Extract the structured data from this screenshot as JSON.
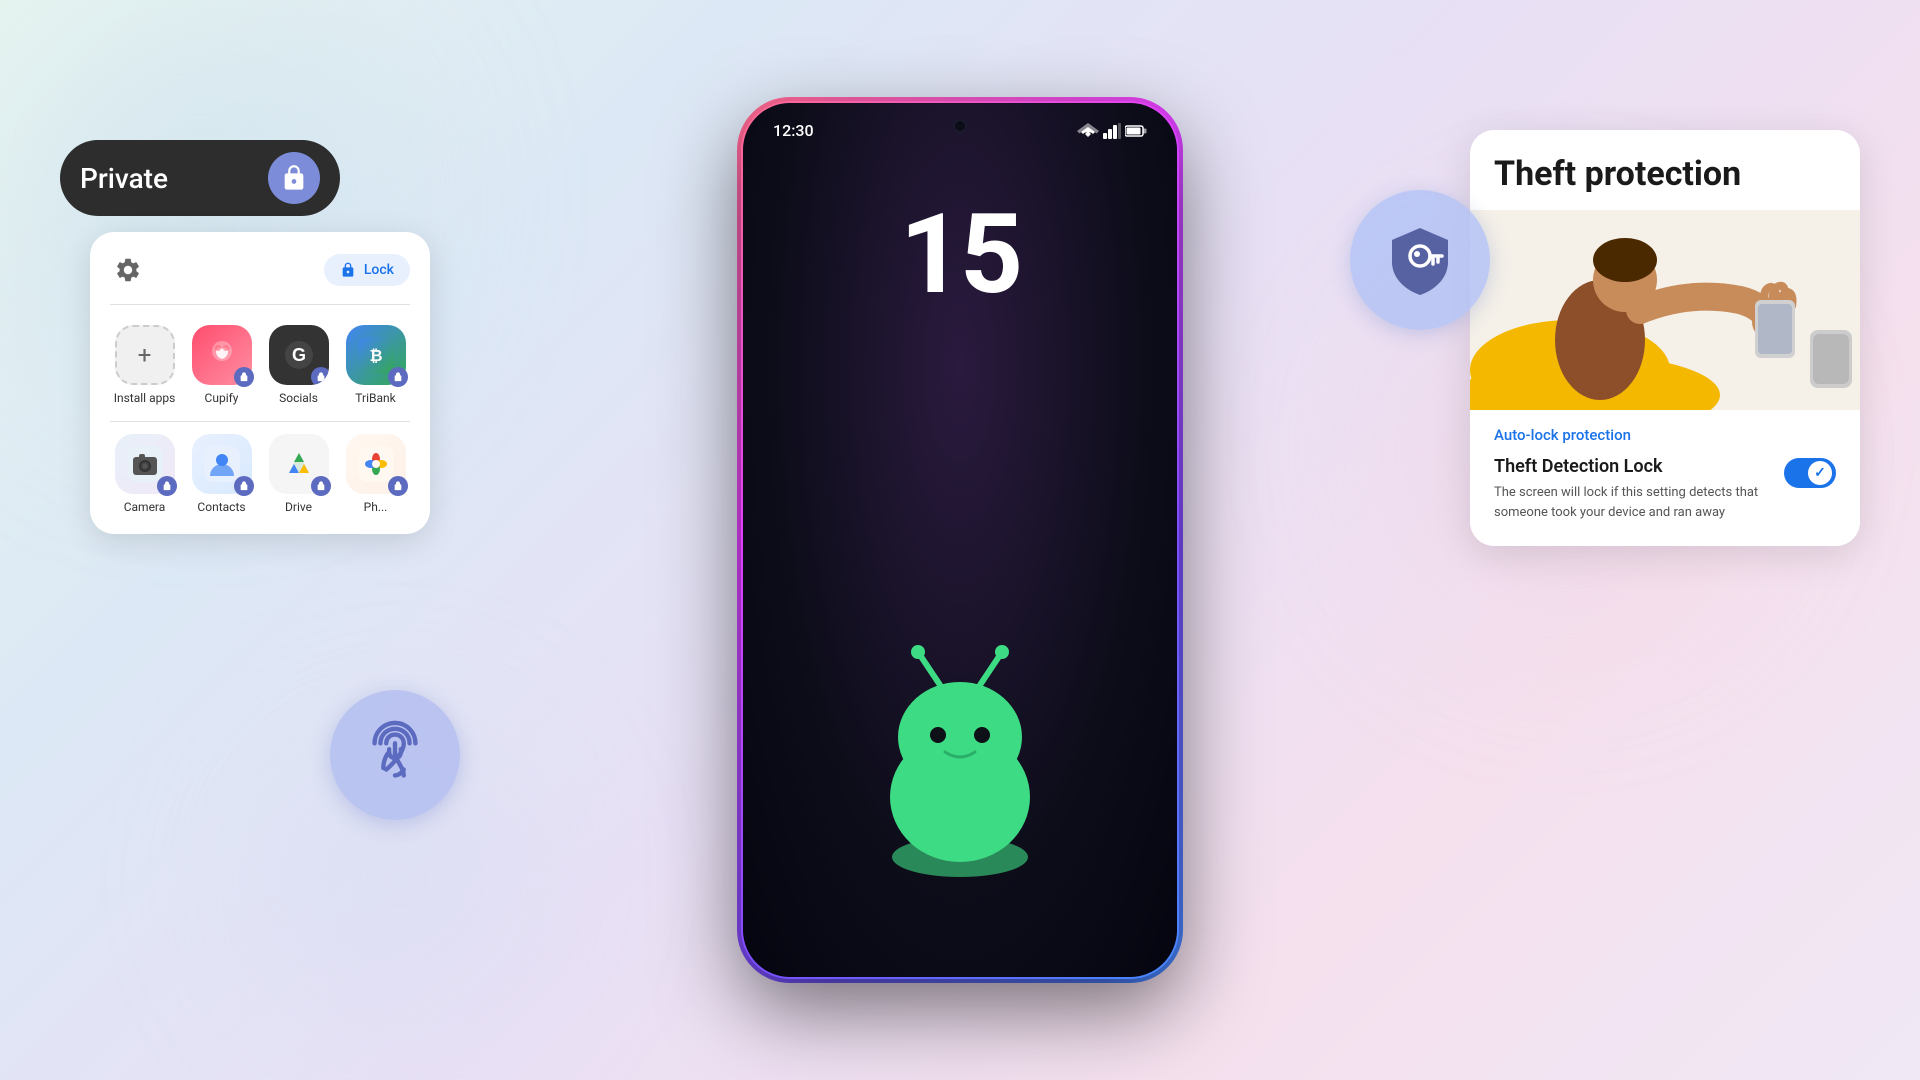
{
  "background": {
    "color_start": "#e8f5f0",
    "color_end": "#f0e8f5"
  },
  "phone": {
    "time": "12:30",
    "clock_display": "15",
    "border_gradient": "linear-gradient(135deg, #ff6b8a, #e040fb, #7c4dff, #448aff)"
  },
  "private_space": {
    "label": "Private",
    "lock_button_label": "Lock",
    "settings_icon": "gear-icon",
    "lock_icon": "lock-icon",
    "apps": [
      {
        "name": "Install apps",
        "icon_type": "plus",
        "label": "Install apps"
      },
      {
        "name": "Cupify",
        "icon_type": "cupify",
        "label": "Cupify"
      },
      {
        "name": "Socials",
        "icon_type": "socials",
        "label": "Socials"
      },
      {
        "name": "TriBank",
        "icon_type": "tribank",
        "label": "TriBank"
      },
      {
        "name": "Camera",
        "icon_type": "camera",
        "label": "Camera"
      },
      {
        "name": "Contacts",
        "icon_type": "contacts",
        "label": "Contacts"
      },
      {
        "name": "Drive",
        "icon_type": "drive",
        "label": "Drive"
      },
      {
        "name": "Photos",
        "icon_type": "photos",
        "label": "Ph..."
      }
    ]
  },
  "theft_protection": {
    "title": "Theft protection",
    "auto_lock_link": "Auto-lock protection",
    "detection_title": "Theft Detection Lock",
    "detection_desc": "The screen will lock if this setting detects that someone took your device and ran away",
    "toggle_state": true,
    "toggle_icon": "checkmark-icon"
  },
  "fingerprint_bubble": {
    "icon": "fingerprint-icon"
  },
  "shield_bubble": {
    "icon": "shield-key-icon"
  }
}
